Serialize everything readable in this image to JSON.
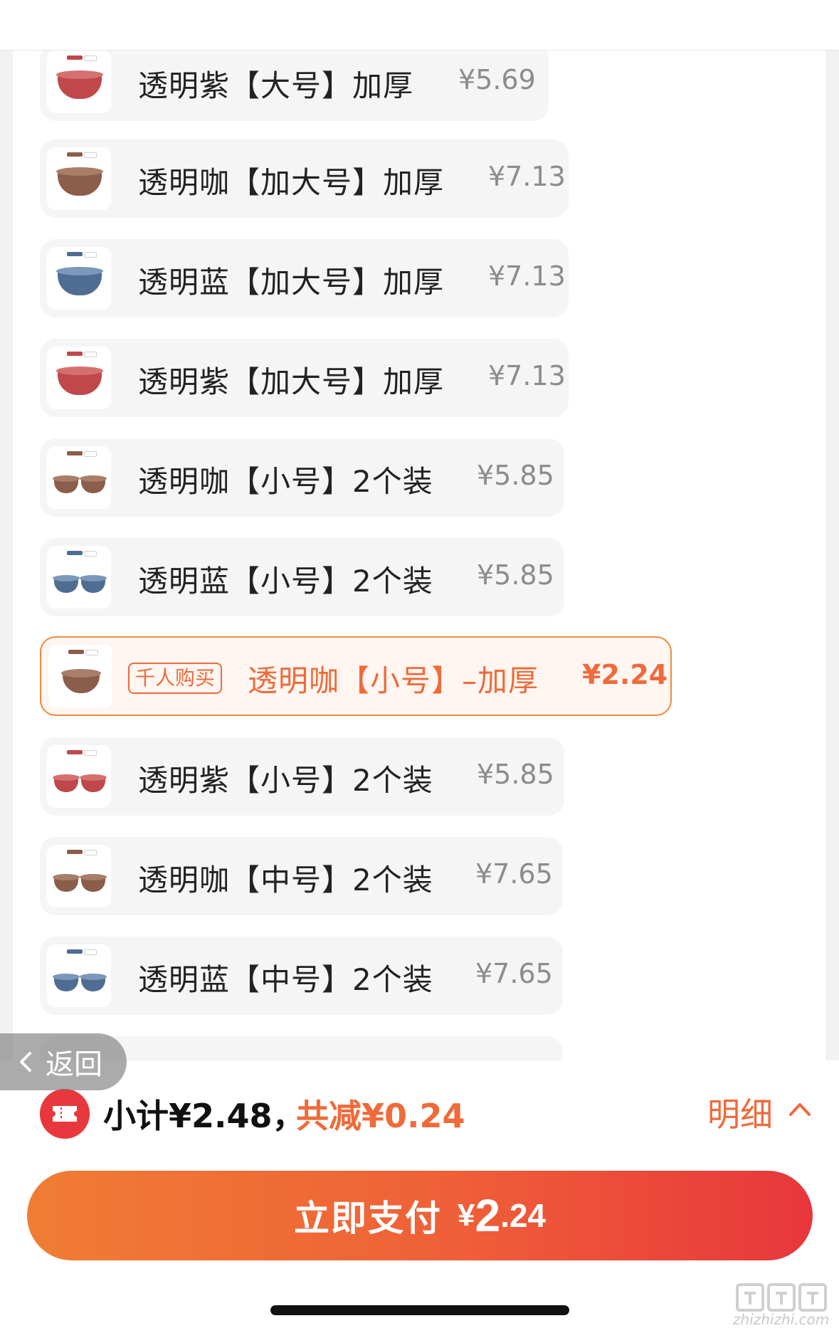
{
  "colors": {
    "accent": "#f06a3a",
    "brown": "#8a5e4b",
    "blue": "#4f6d93",
    "purple": "#c0484a"
  },
  "items": [
    {
      "label": "透明紫【大号】加厚",
      "price": "¥5.69",
      "bowl": "purple",
      "size": "single"
    },
    {
      "label": "透明咖【加大号】加厚",
      "price": "¥7.13",
      "bowl": "brown",
      "size": "single"
    },
    {
      "label": "透明蓝【加大号】加厚",
      "price": "¥7.13",
      "bowl": "blue",
      "size": "single"
    },
    {
      "label": "透明紫【加大号】加厚",
      "price": "¥7.13",
      "bowl": "purple",
      "size": "single"
    },
    {
      "label": "透明咖【小号】2个装",
      "price": "¥5.85",
      "bowl": "brown",
      "size": "pair"
    },
    {
      "label": "透明蓝【小号】2个装",
      "price": "¥5.85",
      "bowl": "blue",
      "size": "pair"
    },
    {
      "label": "透明咖【小号】–加厚",
      "price": "¥2.24",
      "bowl": "brown",
      "size": "single",
      "selected": true,
      "badge": "千人购买"
    },
    {
      "label": "透明紫【小号】2个装",
      "price": "¥5.85",
      "bowl": "purple",
      "size": "pair"
    },
    {
      "label": "透明咖【中号】2个装",
      "price": "¥7.65",
      "bowl": "brown",
      "size": "pair"
    },
    {
      "label": "透明蓝【中号】2个装",
      "price": "¥7.65",
      "bowl": "blue",
      "size": "pair"
    }
  ],
  "back": {
    "label": "返回"
  },
  "summary": {
    "subtotal": "小计¥2.48，",
    "saving": "共减¥0.24",
    "detail": "明细"
  },
  "pay": {
    "label": "立即支付",
    "currency": "¥",
    "amount_int": "2",
    "amount_dec": ".24"
  },
  "watermark": {
    "text": "zhizhizhi.com"
  }
}
